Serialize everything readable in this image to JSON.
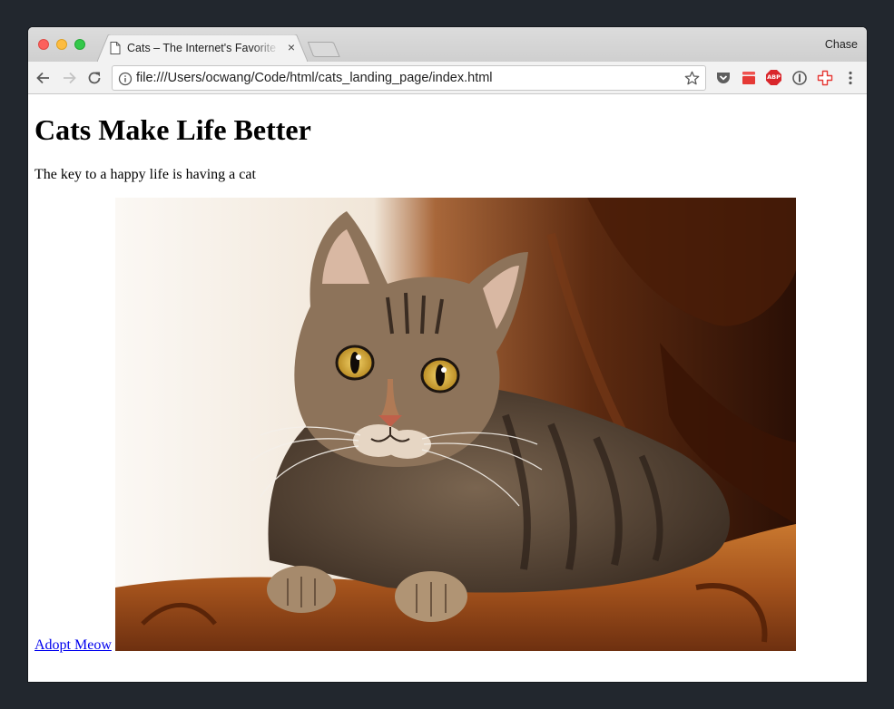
{
  "browser": {
    "tab": {
      "title": "Cats – The Internet's Favorite Animal",
      "close_glyph": "×"
    },
    "profile_name": "Chase",
    "address": {
      "url": "file:///Users/ocwang/Code/html/cats_landing_page/index.html"
    },
    "extensions": {
      "abp_label": "ABP"
    }
  },
  "page": {
    "heading": "Cats Make Life Better",
    "tagline": "The key to a happy life is having a cat",
    "link_text": "Adopt Meow",
    "image_subject": "tabby-cat-photo"
  },
  "colors": {
    "desktop": "#22272e",
    "link": "#0000ee",
    "abp_red": "#d9262b"
  }
}
